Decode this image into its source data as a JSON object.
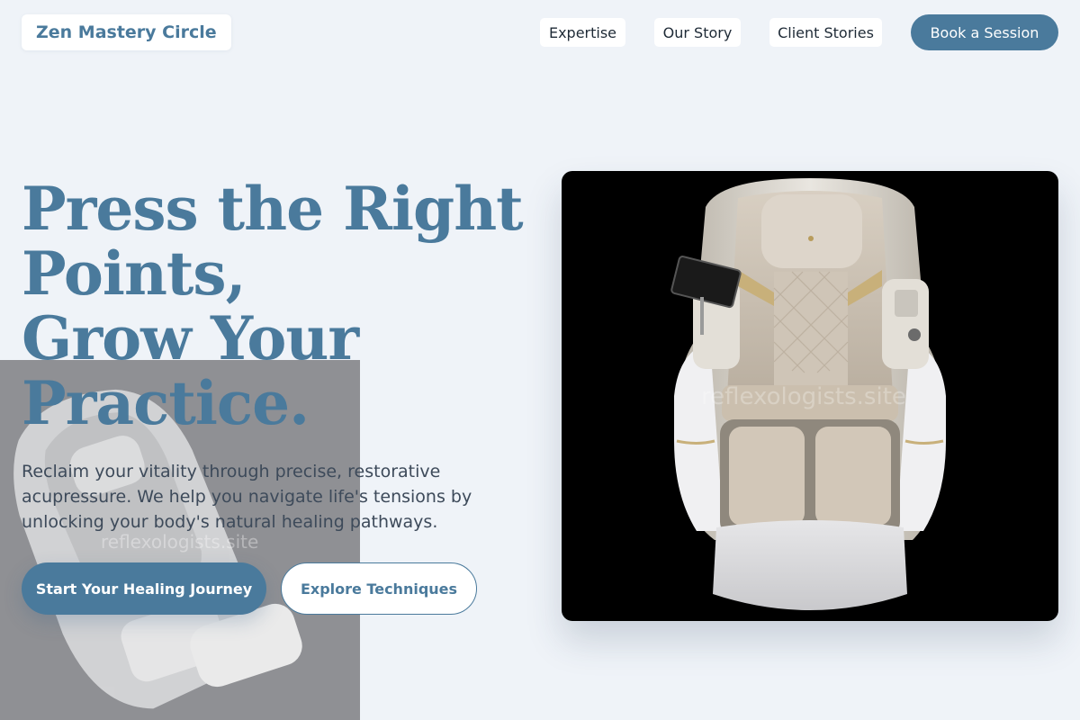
{
  "header": {
    "brand": "Zen Mastery Circle",
    "nav": [
      {
        "label": "Expertise"
      },
      {
        "label": "Our Story"
      },
      {
        "label": "Client Stories"
      }
    ],
    "cta": "Book a Session"
  },
  "hero": {
    "title_lines": [
      "Press the Right",
      "Points,",
      "Grow Your",
      "Practice."
    ],
    "subtitle": "Reclaim your vitality through precise, restorative acupressure. We help you navigate life's tensions by unlocking your body's natural healing pathways.",
    "primary_button": "Start Your Healing Journey",
    "secondary_button": "Explore Techniques",
    "image_watermark": "reflexologists.site",
    "backdrop_watermark": "reflexologists.site"
  },
  "colors": {
    "accent": "#4a7a9c",
    "background": "#eff3f8",
    "text": "#3d4a5a"
  }
}
